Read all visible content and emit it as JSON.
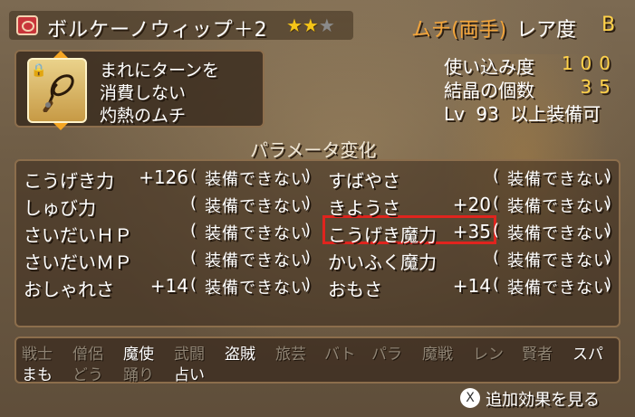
{
  "header": {
    "item_name": "ボルケーノウィップ＋2",
    "stars_filled": "★★",
    "stars_empty": "★",
    "weapon_type": "ムチ(両手)",
    "rarity_label": "レア度",
    "rarity_value": "B"
  },
  "item": {
    "effects": [
      "まれにターンを",
      "消費しない",
      "灼熱のムチ"
    ]
  },
  "info": {
    "proficiency_label": "使い込み度",
    "proficiency_value": "100",
    "crystals_label": "結晶の個数",
    "crystals_value": "35",
    "level_label": "Lv",
    "level_value": "93",
    "level_suffix": "以上装備可"
  },
  "params": {
    "title": "パラメータ変化",
    "left": [
      {
        "name": "こうげき力",
        "value": "+126",
        "text": "装備できない"
      },
      {
        "name": "しゅび力",
        "value": "",
        "text": "装備できない"
      },
      {
        "name": "さいだいＨＰ",
        "value": "",
        "text": "装備できない"
      },
      {
        "name": "さいだいＭＰ",
        "value": "",
        "text": "装備できない"
      },
      {
        "name": "おしゃれさ",
        "value": "+14",
        "text": "装備できない"
      }
    ],
    "right": [
      {
        "name": "すばやさ",
        "value": "",
        "text": "装備できない"
      },
      {
        "name": "きようさ",
        "value": "+20",
        "text": "装備できない"
      },
      {
        "name": "こうげき魔力",
        "value": "+35",
        "text": "装備できない"
      },
      {
        "name": "かいふく魔力",
        "value": "",
        "text": "装備できない"
      },
      {
        "name": "おもさ",
        "value": "+14",
        "text": "装備できない"
      }
    ],
    "paren_open": "(",
    "paren_close": ")"
  },
  "jobs": {
    "row1": [
      {
        "label": "戦士",
        "enabled": false
      },
      {
        "label": "僧侶",
        "enabled": false
      },
      {
        "label": "魔使",
        "enabled": true
      },
      {
        "label": "武闘",
        "enabled": false
      },
      {
        "label": "盗賊",
        "enabled": true
      },
      {
        "label": "旅芸",
        "enabled": false
      },
      {
        "label": "バト",
        "enabled": false
      },
      {
        "label": "パラ",
        "enabled": false
      },
      {
        "label": "魔戦",
        "enabled": false
      },
      {
        "label": "レン",
        "enabled": false
      },
      {
        "label": "賢者",
        "enabled": false
      },
      {
        "label": "スパ",
        "enabled": true
      }
    ],
    "row2": [
      {
        "label": "まも",
        "enabled": true
      },
      {
        "label": "どう",
        "enabled": false
      },
      {
        "label": "踊り",
        "enabled": false
      },
      {
        "label": "占い",
        "enabled": true
      }
    ]
  },
  "footer": {
    "button_glyph": "X",
    "label": "追加効果を見る"
  },
  "colors": {
    "accent_orange": "#f2a43a",
    "value_yellow": "#ffd24a",
    "highlight_red": "#e0241e"
  },
  "icons": {
    "type_icon": "whip-type-icon",
    "lock": "lock-icon",
    "button": "x-button-icon"
  }
}
